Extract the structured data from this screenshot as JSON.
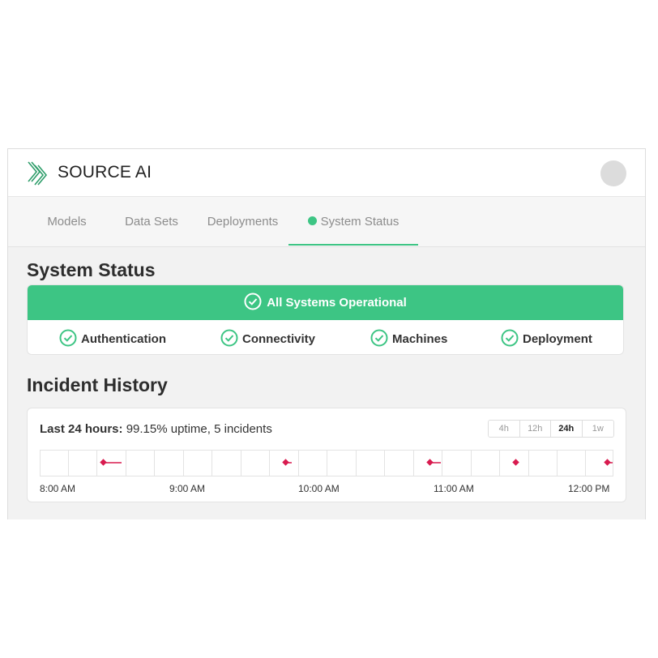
{
  "header": {
    "brand": "SOURCE AI"
  },
  "nav": {
    "tabs": [
      {
        "label": "Models",
        "active": false
      },
      {
        "label": "Data Sets",
        "active": false
      },
      {
        "label": "Deployments",
        "active": false
      },
      {
        "label": "System Status",
        "active": true
      }
    ]
  },
  "system_status": {
    "title": "System Status",
    "banner": "All Systems Operational",
    "services": [
      "Authentication",
      "Connectivity",
      "Machines",
      "Deployment"
    ]
  },
  "incident_history": {
    "title": "Incident History",
    "summary_label": "Last 24 hours:",
    "summary_text": "99.15% uptime, 5 incidents",
    "ranges": [
      {
        "label": "4h",
        "active": false
      },
      {
        "label": "12h",
        "active": false
      },
      {
        "label": "24h",
        "active": true
      },
      {
        "label": "1w",
        "active": false
      }
    ],
    "time_labels": [
      "8:00 AM",
      "9:00 AM",
      "10:00 AM",
      "11:00 AM",
      "12:00 PM"
    ]
  },
  "colors": {
    "accent": "#3dc584",
    "incident": "#d81b4f"
  }
}
